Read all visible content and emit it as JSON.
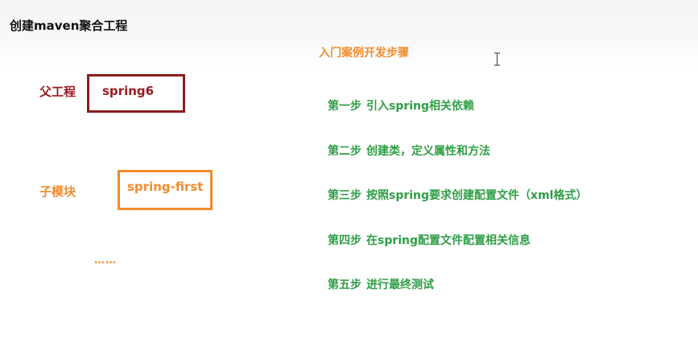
{
  "slide": {
    "title": "创建maven聚合工程"
  },
  "left": {
    "parent_label": "父工程",
    "parent_name": "spring6",
    "child_label": "子模块",
    "child_name": "spring-first",
    "ellipsis": "……"
  },
  "right": {
    "heading": "入门案例开发步骤",
    "steps": [
      {
        "num": "第一步",
        "text": "引入spring相关依赖"
      },
      {
        "num": "第二步",
        "text": "创建类，定义属性和方法"
      },
      {
        "num": "第三步",
        "text": "按照spring要求创建配置文件（xml格式）"
      },
      {
        "num": "第四步",
        "text": "在spring配置文件配置相关信息"
      },
      {
        "num": "第五步",
        "text": "进行最终测试"
      }
    ]
  },
  "colors": {
    "dark_red": "#9b1b22",
    "orange": "#f28b2c",
    "green": "#2e9e45"
  },
  "icons": {
    "cursor": "text-cursor-icon"
  }
}
